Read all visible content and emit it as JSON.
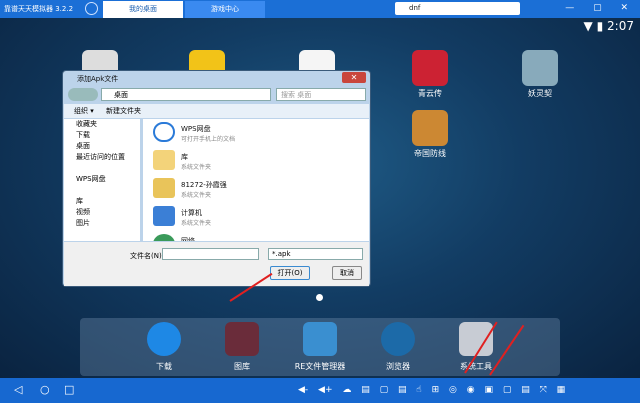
{
  "topbar": {
    "app_title": "靠谱天天模拟器 3.2.2",
    "tabs": [
      "我的桌面",
      "游戏中心"
    ],
    "search_value": "dnf",
    "window_controls": "— ▢ ✕"
  },
  "status": {
    "time": "2:07",
    "wifi": "▼",
    "battery": "▮"
  },
  "desktop_apps": [
    {
      "label": ""
    },
    {
      "label": ""
    },
    {
      "label": ""
    },
    {
      "label": "青云传"
    },
    {
      "label": "妖灵契"
    },
    {
      "label": "帝国防线"
    }
  ],
  "dialog": {
    "title": "添加Apk文件",
    "address": "桌面",
    "search_placeholder": "搜索 桌面",
    "toolbar": [
      "组织 ▾",
      "新建文件夹"
    ],
    "nav": [
      "收藏夹",
      "下载",
      "桌面",
      "最近访问的位置",
      "",
      "WPS网盘",
      "",
      "库",
      "视频",
      "图片"
    ],
    "items": [
      {
        "name": "WPS网盘",
        "sub": "可打开手机上的文档"
      },
      {
        "name": "库",
        "sub": "系统文件夹"
      },
      {
        "name": "81272-孙霞强",
        "sub": "系统文件夹"
      },
      {
        "name": "计算机",
        "sub": "系统文件夹"
      },
      {
        "name": "网络",
        "sub": ""
      }
    ],
    "filename_label": "文件名(N):",
    "filename_value": "",
    "filetype": "*.apk",
    "open_label": "打开(O)",
    "cancel_label": "取消"
  },
  "dock": [
    {
      "label": "下载"
    },
    {
      "label": "图库"
    },
    {
      "label": "RE文件管理器"
    },
    {
      "label": "浏览器"
    },
    {
      "label": "系统工具"
    }
  ],
  "navbar": {
    "back": "◁",
    "home": "○",
    "recent": "□",
    "tray": "◀- ◀+ ☁ ▤ ▢ ▤ ☝ ⊞ ◎ ◉ ▣ ▢ ▤ ⤧ ▦"
  },
  "colors": {
    "accent": "#1b6fd6",
    "arrow": "#e02020"
  }
}
